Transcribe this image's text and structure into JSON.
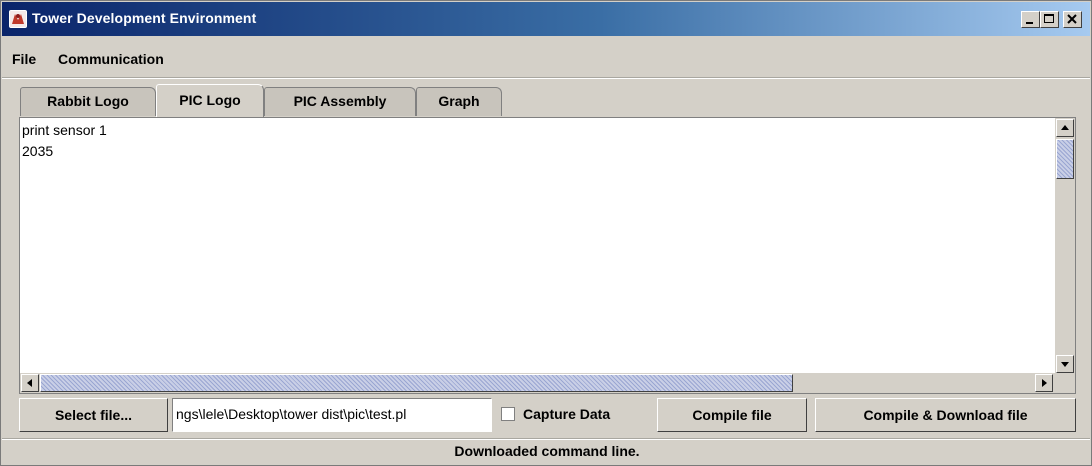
{
  "window": {
    "title": "Tower Development Environment",
    "titlebar_color_start": "#0a246a",
    "titlebar_color_end": "#a6caf0"
  },
  "menu": [
    "File",
    "Communication"
  ],
  "tabs": [
    {
      "label": "Rabbit Logo",
      "selected": false
    },
    {
      "label": "PIC Logo",
      "selected": true
    },
    {
      "label": "PIC Assembly",
      "selected": false
    },
    {
      "label": "Graph",
      "selected": false
    }
  ],
  "editor": {
    "lines": [
      "print sensor 1",
      "2035"
    ]
  },
  "controls": {
    "select_file_label": "Select file...",
    "file_path_value": "ngs\\lele\\Desktop\\tower dist\\pic\\test.pl",
    "capture_label": "Capture Data",
    "capture_checked": false,
    "compile_label": "Compile file",
    "compile_download_label": "Compile & Download file"
  },
  "status": "Downloaded command line."
}
